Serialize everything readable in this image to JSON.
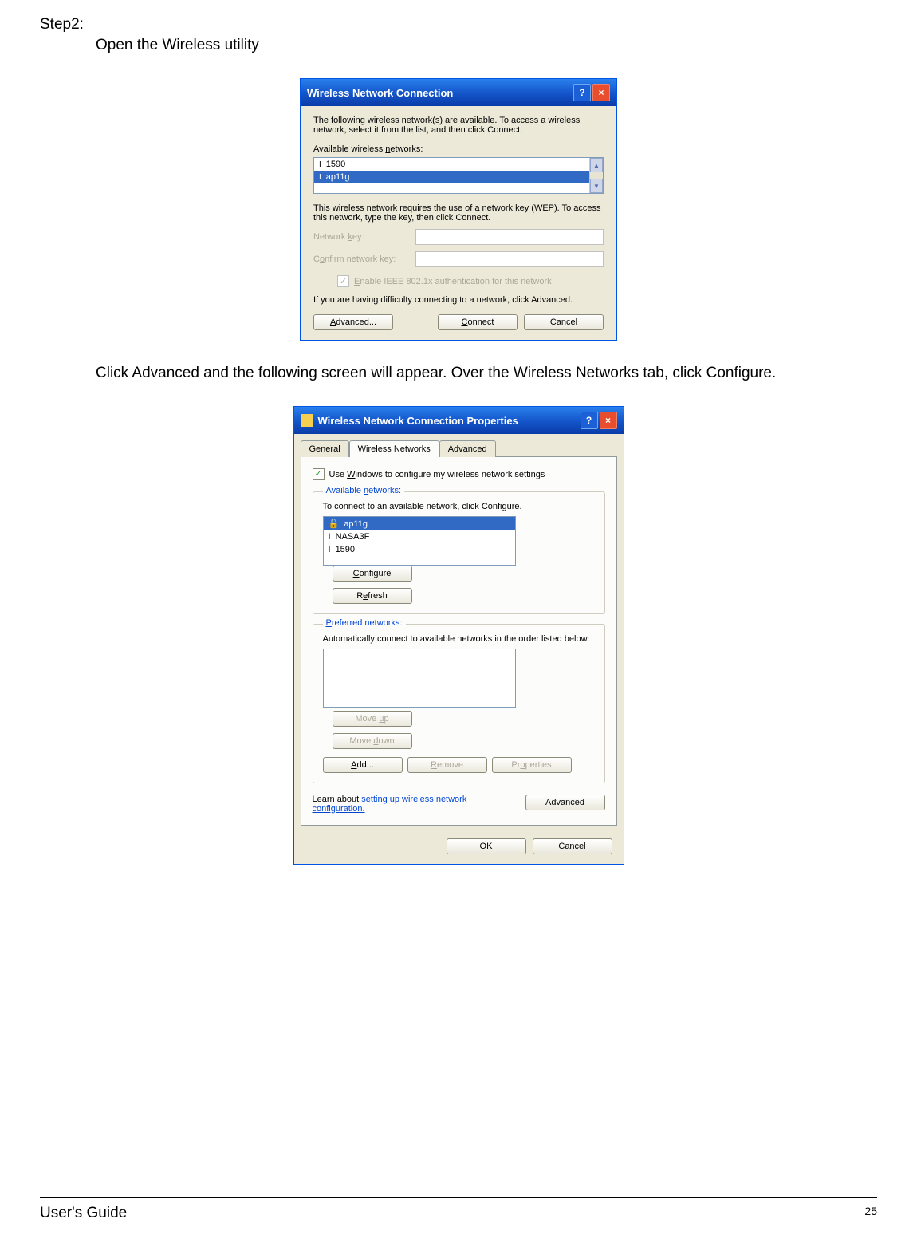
{
  "step": {
    "number": "Step2:",
    "instruction": "Open the Wireless utility",
    "description": "Click Advanced and the following screen will appear. Over the Wireless Networks tab, click Configure."
  },
  "dialog1": {
    "title": "Wireless Network Connection",
    "info_text": "The following wireless network(s) are available. To access a wireless network, select it from the list, and then click Connect.",
    "available_label": "Available wireless networks:",
    "networks": [
      {
        "name": "1590",
        "selected": false
      },
      {
        "name": "ap11g",
        "selected": true
      }
    ],
    "wep_text": "This wireless network requires the use of a network key (WEP). To access this network, type the key, then click Connect.",
    "network_key_label": "Network key:",
    "confirm_key_label": "Confirm network key:",
    "enable_8021x_label": "Enable IEEE 802.1x authentication for this network",
    "difficulty_text": "If you are having difficulty connecting to a network, click Advanced.",
    "buttons": {
      "advanced": "Advanced...",
      "connect": "Connect",
      "cancel": "Cancel"
    }
  },
  "dialog2": {
    "title": "Wireless Network Connection Properties",
    "tabs": {
      "general": "General",
      "wireless": "Wireless Networks",
      "advanced": "Advanced"
    },
    "use_windows_label": "Use Windows to configure my wireless network settings",
    "available_legend": "Available networks:",
    "available_desc": "To connect to an available network, click Configure.",
    "available_list": [
      {
        "name": "ap11g",
        "selected": true,
        "icon": "secured"
      },
      {
        "name": "NASA3F",
        "selected": false,
        "icon": "open"
      },
      {
        "name": "1590",
        "selected": false,
        "icon": "open"
      }
    ],
    "preferred_legend": "Preferred networks:",
    "preferred_desc": "Automatically connect to available networks in the order listed below:",
    "buttons": {
      "configure": "Configure",
      "refresh": "Refresh",
      "moveup": "Move up",
      "movedown": "Move down",
      "add": "Add...",
      "remove": "Remove",
      "properties": "Properties",
      "advanced": "Advanced",
      "ok": "OK",
      "cancel": "Cancel"
    },
    "learn_text": "Learn about ",
    "learn_link": "setting up wireless network configuration."
  },
  "footer": {
    "guide": "User's Guide",
    "page": "25"
  }
}
